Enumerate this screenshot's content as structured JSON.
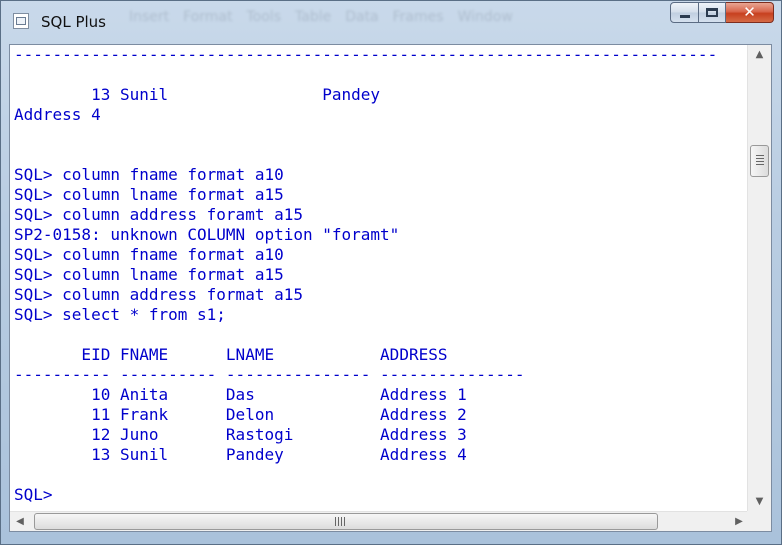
{
  "window": {
    "title": "SQL Plus",
    "ghost_menu": [
      "Insert",
      "Format",
      "Tools",
      "Table",
      "Data",
      "Frames",
      "Window"
    ],
    "close_glyph": "✕"
  },
  "console": {
    "lines": [
      "-------------------------------------------------------------------------",
      "",
      "        13 Sunil                Pandey",
      "Address 4",
      "",
      "",
      "SQL> column fname format a10",
      "SQL> column lname format a15",
      "SQL> column address foramt a15",
      "SP2-0158: unknown COLUMN option \"foramt\"",
      "SQL> column fname format a10",
      "SQL> column lname format a15",
      "SQL> column address format a15",
      "SQL> select * from s1;",
      "",
      "       EID FNAME      LNAME           ADDRESS",
      "---------- ---------- --------------- ---------------",
      "        10 Anita      Das             Address 1",
      "        11 Frank      Delon           Address 2",
      "        12 Juno       Rastogi         Address 3",
      "        13 Sunil      Pandey          Address 4",
      "",
      "SQL>"
    ],
    "text_color": "#0000cc"
  },
  "scrollbars": {
    "up_arrow": "▲",
    "down_arrow": "▼",
    "left_arrow": "◀",
    "right_arrow": "▶"
  }
}
